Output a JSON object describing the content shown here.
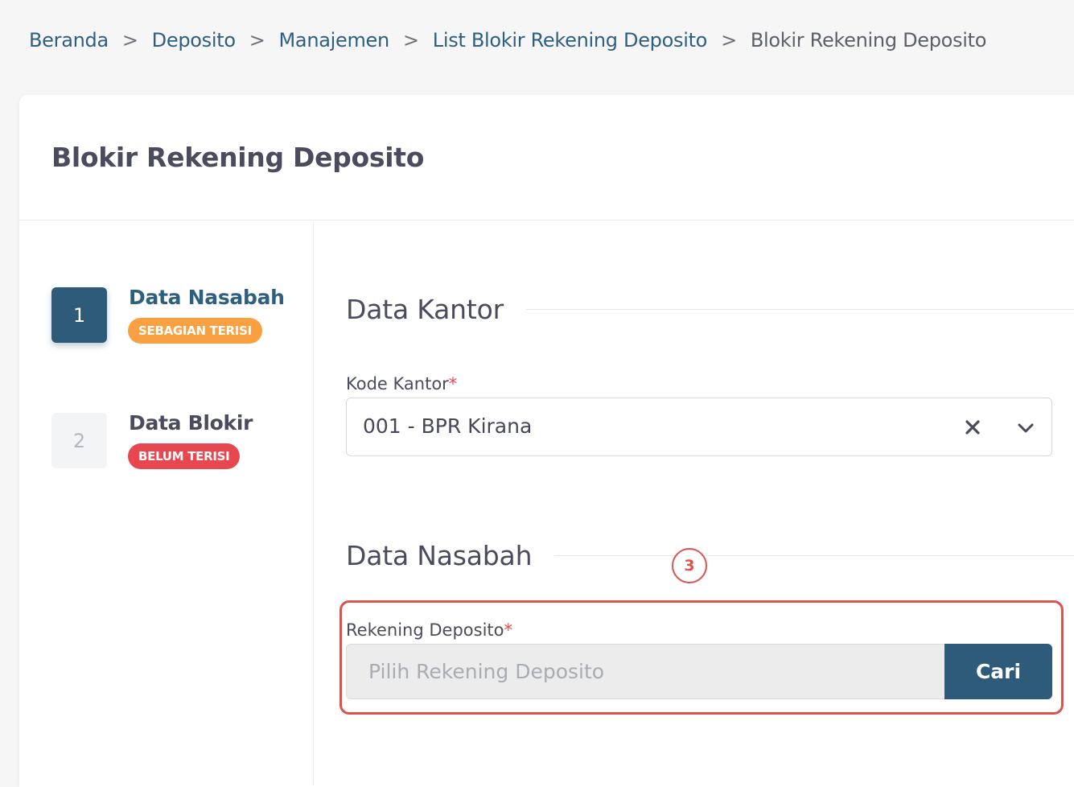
{
  "breadcrumb": {
    "items": [
      "Beranda",
      "Deposito",
      "Manajemen",
      "List Blokir Rekening Deposito"
    ],
    "current": "Blokir Rekening Deposito",
    "separator": ">"
  },
  "page": {
    "title": "Blokir Rekening Deposito"
  },
  "steps": [
    {
      "number": "1",
      "title": "Data Nasabah",
      "status": "SEBAGIAN TERISI",
      "active": true
    },
    {
      "number": "2",
      "title": "Data Blokir",
      "status": "BELUM TERISI",
      "active": false
    }
  ],
  "sections": {
    "kantor": {
      "title": "Data Kantor",
      "kode_kantor": {
        "label": "Kode Kantor",
        "required_mark": "*",
        "value": "001 - BPR Kirana"
      }
    },
    "nasabah": {
      "title": "Data Nasabah",
      "rekening": {
        "label": "Rekening Deposito",
        "required_mark": "*",
        "placeholder": "Pilih Rekening Deposito",
        "button_label": "Cari"
      }
    }
  },
  "annotation": {
    "marker_number": "3"
  },
  "icons": {
    "clear": "close-icon",
    "dropdown": "chevron-down-icon",
    "separator": "chevron-right-icon"
  },
  "colors": {
    "primary": "#2e5b79",
    "badge_partial": "#fba040",
    "badge_empty": "#e8474f",
    "annotation": "#d9534f",
    "required": "#e8474f"
  }
}
